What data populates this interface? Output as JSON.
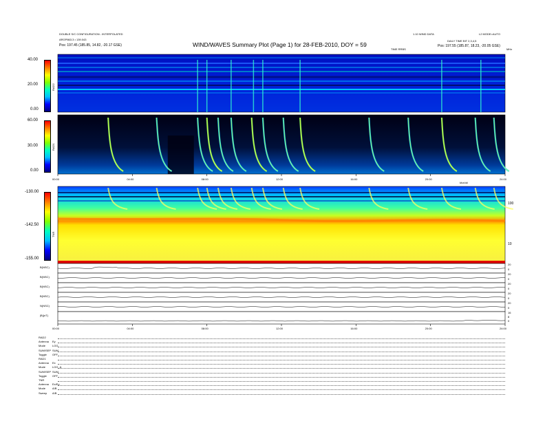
{
  "header": {
    "left_line1": "DOUBLE S/C CONFIGURATION - INTERPOLATED",
    "left_line2": "ARGP863.3 • 139.043",
    "left_line3": "Pos: 197.45 (185.85, 14.82, -20.17 GSE)",
    "title": "WIND/WAVES Summary Plot (Page 1) for 28-FEB-2010, DOY = 59",
    "right_top_a": "1.10 WIND DATA",
    "right_top_b": "L2 MODE=AUTO",
    "right_line2": "DAILY TIME BIT 2,3,4,5",
    "right_line3": "Pos: 197.55 (185.87, 18.23, -20.05 GSE)",
    "radio_label_top": "TIME RRBS",
    "radio_unit_top": "MHz",
    "tnr_unit": "khz/dd"
  },
  "panels": {
    "rad2": {
      "name": "RAD2",
      "ticks": [
        "40.00",
        "20.00",
        "0.00"
      ]
    },
    "rad1": {
      "name": "RAD1",
      "ticks": [
        "60.00",
        "30.00",
        "0.00"
      ]
    },
    "tnr": {
      "name": "TNR",
      "ticks": [
        "-130.00",
        "-142.50",
        "-155.00"
      ],
      "right_ticks": [
        "100",
        "10"
      ]
    }
  },
  "time_axis": {
    "labels": [
      "00:00",
      "04:00",
      "08:00",
      "12:00",
      "16:00",
      "20:00",
      "24:00"
    ]
  },
  "line_panels": [
    {
      "label": "B(NSC)",
      "right": [
        "20",
        "0"
      ]
    },
    {
      "label": "B(NSC)",
      "right": [
        "20",
        "0"
      ]
    },
    {
      "label": "B(NSC)",
      "right": [
        "20",
        "0"
      ]
    },
    {
      "label": "B(NSC)",
      "right": [
        "20",
        "0"
      ]
    },
    {
      "label": "N(NSC)",
      "right": [
        "20",
        "0"
      ]
    },
    {
      "label": "|B|(nT)",
      "right": [
        "16",
        "8",
        "0"
      ]
    }
  ],
  "footer_rows": [
    {
      "k": "RAD2",
      "v": ""
    },
    {
      "k": "Antenna",
      "v": "Ey"
    },
    {
      "k": "Mode",
      "v": "LOG"
    },
    {
      "k": "SUM/SEP",
      "v": "SUM"
    },
    {
      "k": "Toggle",
      "v": "OFF"
    },
    {
      "k": "RAD1",
      "v": ""
    },
    {
      "k": "Antenna",
      "v": "Ex"
    },
    {
      "k": "Mode",
      "v": "LOG_A"
    },
    {
      "k": "SUM/SEP",
      "v": "SUM"
    },
    {
      "k": "Toggle",
      "v": "OFF"
    },
    {
      "k": "TNR",
      "v": ""
    },
    {
      "k": "Antenna",
      "v": "Ex/Ey"
    },
    {
      "k": "Mode",
      "v": "A/B"
    },
    {
      "k": "Sweep",
      "v": "A/B"
    }
  ],
  "chart_data": {
    "type": "heatmap",
    "title": "WIND/WAVES Summary Plot (Page 1) for 28-FEB-2010, DOY = 59",
    "x": {
      "unit": "UT",
      "range": [
        "00:00",
        "24:00"
      ],
      "ticks": [
        "00:00",
        "04:00",
        "08:00",
        "12:00",
        "16:00",
        "20:00",
        "24:00"
      ]
    },
    "panels": [
      {
        "name": "RAD2",
        "ylim": [
          0,
          40
        ],
        "ticks": [
          40,
          20,
          0
        ]
      },
      {
        "name": "RAD1",
        "ylim": [
          0,
          60
        ],
        "ticks": [
          60,
          30,
          0
        ]
      },
      {
        "name": "TNR",
        "ylim": [
          -155,
          -130
        ],
        "ticks": [
          -130,
          -142.5,
          -155
        ]
      }
    ],
    "bursts_hours": [
      2.7,
      5.3,
      7.5,
      8.0,
      8.6,
      9.3,
      10.4,
      11.0,
      12.1,
      13.0,
      16.7,
      18.8,
      20.6,
      22.4,
      23.4
    ],
    "colormap": [
      "#00007f",
      "#0000ff",
      "#00bfff",
      "#00ffbf",
      "#7fff00",
      "#ffff00",
      "#ff7f00",
      "#ff0000"
    ]
  }
}
